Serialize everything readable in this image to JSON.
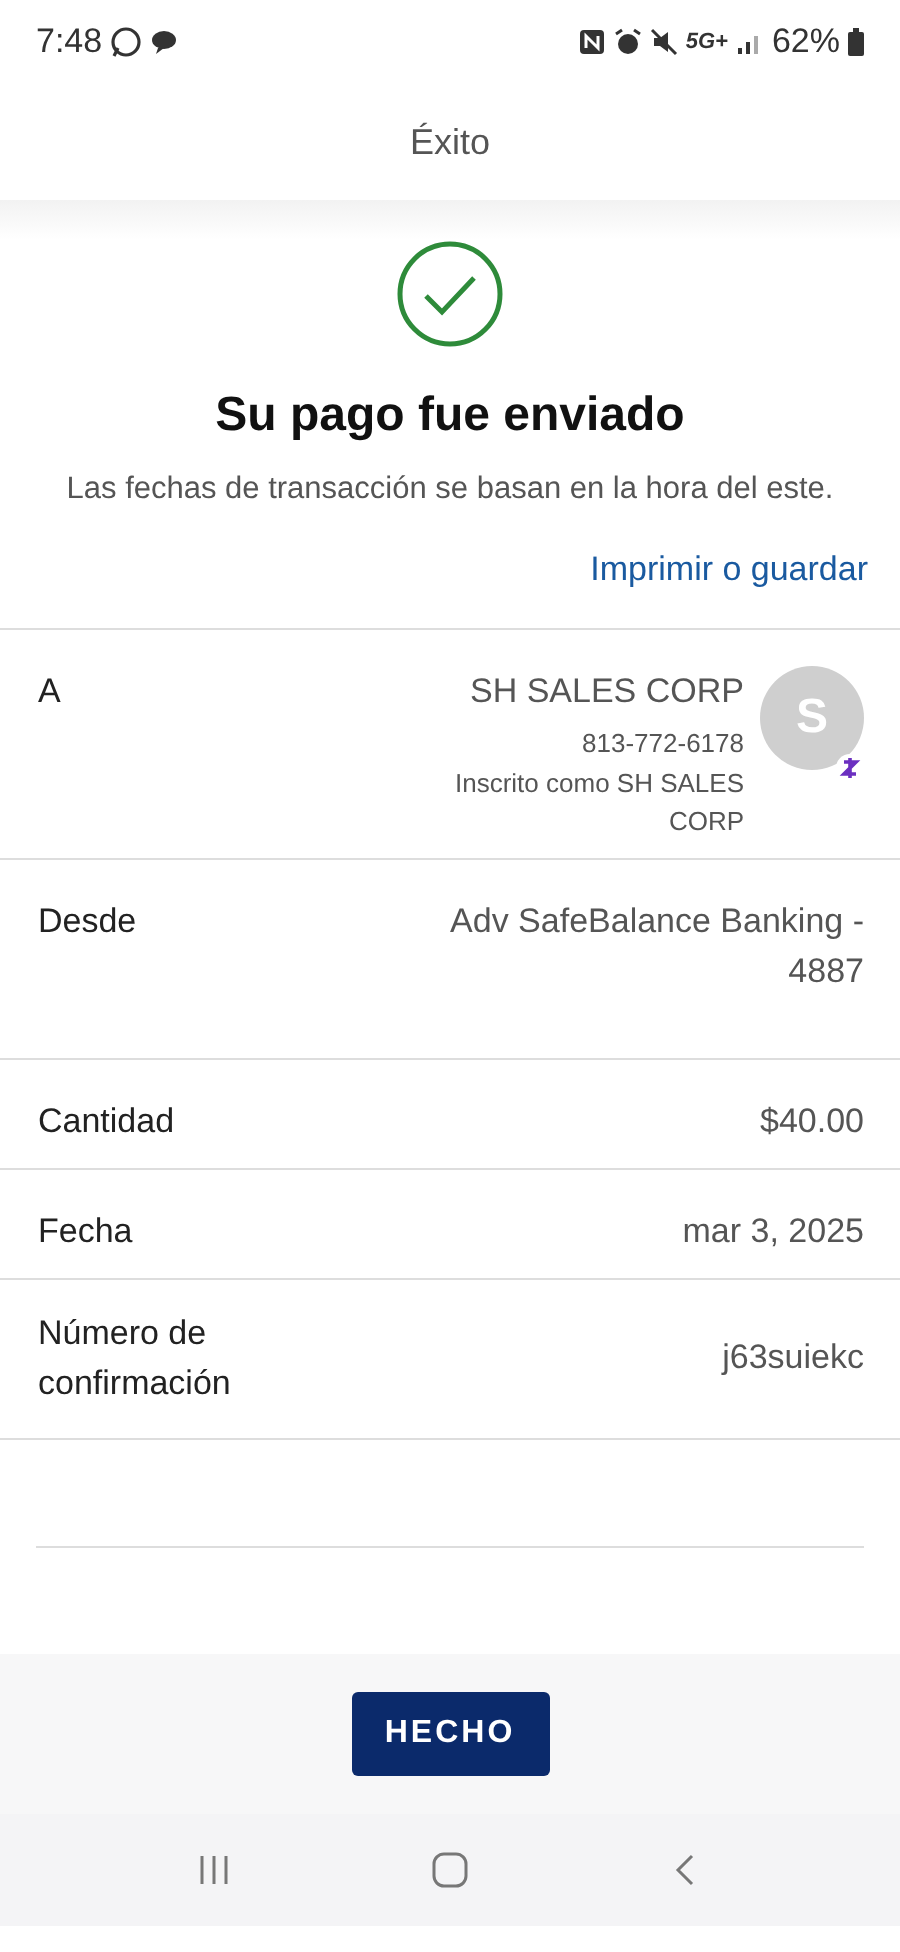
{
  "status_bar": {
    "time": "7:48",
    "network": "5G+",
    "battery": "62%"
  },
  "header": {
    "title": "Éxito"
  },
  "result": {
    "title": "Su pago fue enviado",
    "note": "Las fechas de transacción se basan en la hora del este.",
    "link": "Imprimir o guardar"
  },
  "details": [
    {
      "kind": "payee",
      "label": "A",
      "value": "SH SALES CORP",
      "phone": "813-772-6178",
      "enrolled": "Inscrito como SH SALES CORP",
      "avatar": "S"
    },
    {
      "kind": "plain",
      "label": "Desde",
      "value": "Adv SafeBalance Banking - 4887"
    },
    {
      "kind": "plain",
      "label": "Cantidad",
      "value": "$40.00"
    },
    {
      "kind": "plain",
      "label": "Fecha",
      "value": "mar 3, 2025"
    },
    {
      "kind": "plain",
      "label": "Número de confirmación",
      "value": "j63suiekc"
    }
  ],
  "done_button": "HECHO"
}
